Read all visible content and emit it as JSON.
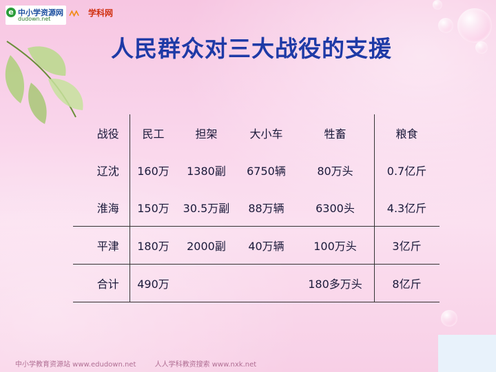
{
  "header": {
    "logo_left_name": "中小学资源网",
    "logo_left_url": "dudown.net",
    "logo_right_name": "学科网"
  },
  "title": "人民群众对三大战役的支援",
  "table": {
    "headers": [
      "战役",
      "民工",
      "担架",
      "大小车",
      "牲畜",
      "粮食"
    ],
    "rows": [
      [
        "辽沈",
        "160万",
        "1380副",
        "6750辆",
        "80万头",
        "0.7亿斤"
      ],
      [
        "淮海",
        "150万",
        "30.5万副",
        "88万辆",
        "6300头",
        "4.3亿斤"
      ],
      [
        "平津",
        "180万",
        "2000副",
        "40万辆",
        "100万头",
        "3亿斤"
      ],
      [
        "合计",
        "490万",
        "",
        "",
        "180多万头",
        "8亿斤"
      ]
    ]
  },
  "footer": {
    "left": "中小学教育资源站 www.edudown.net",
    "right": "人人学科教资搜索 www.nxk.net"
  },
  "colors": {
    "title": "#1e3aa6",
    "background": "#f9d3ea",
    "text": "#1a1a3a"
  }
}
